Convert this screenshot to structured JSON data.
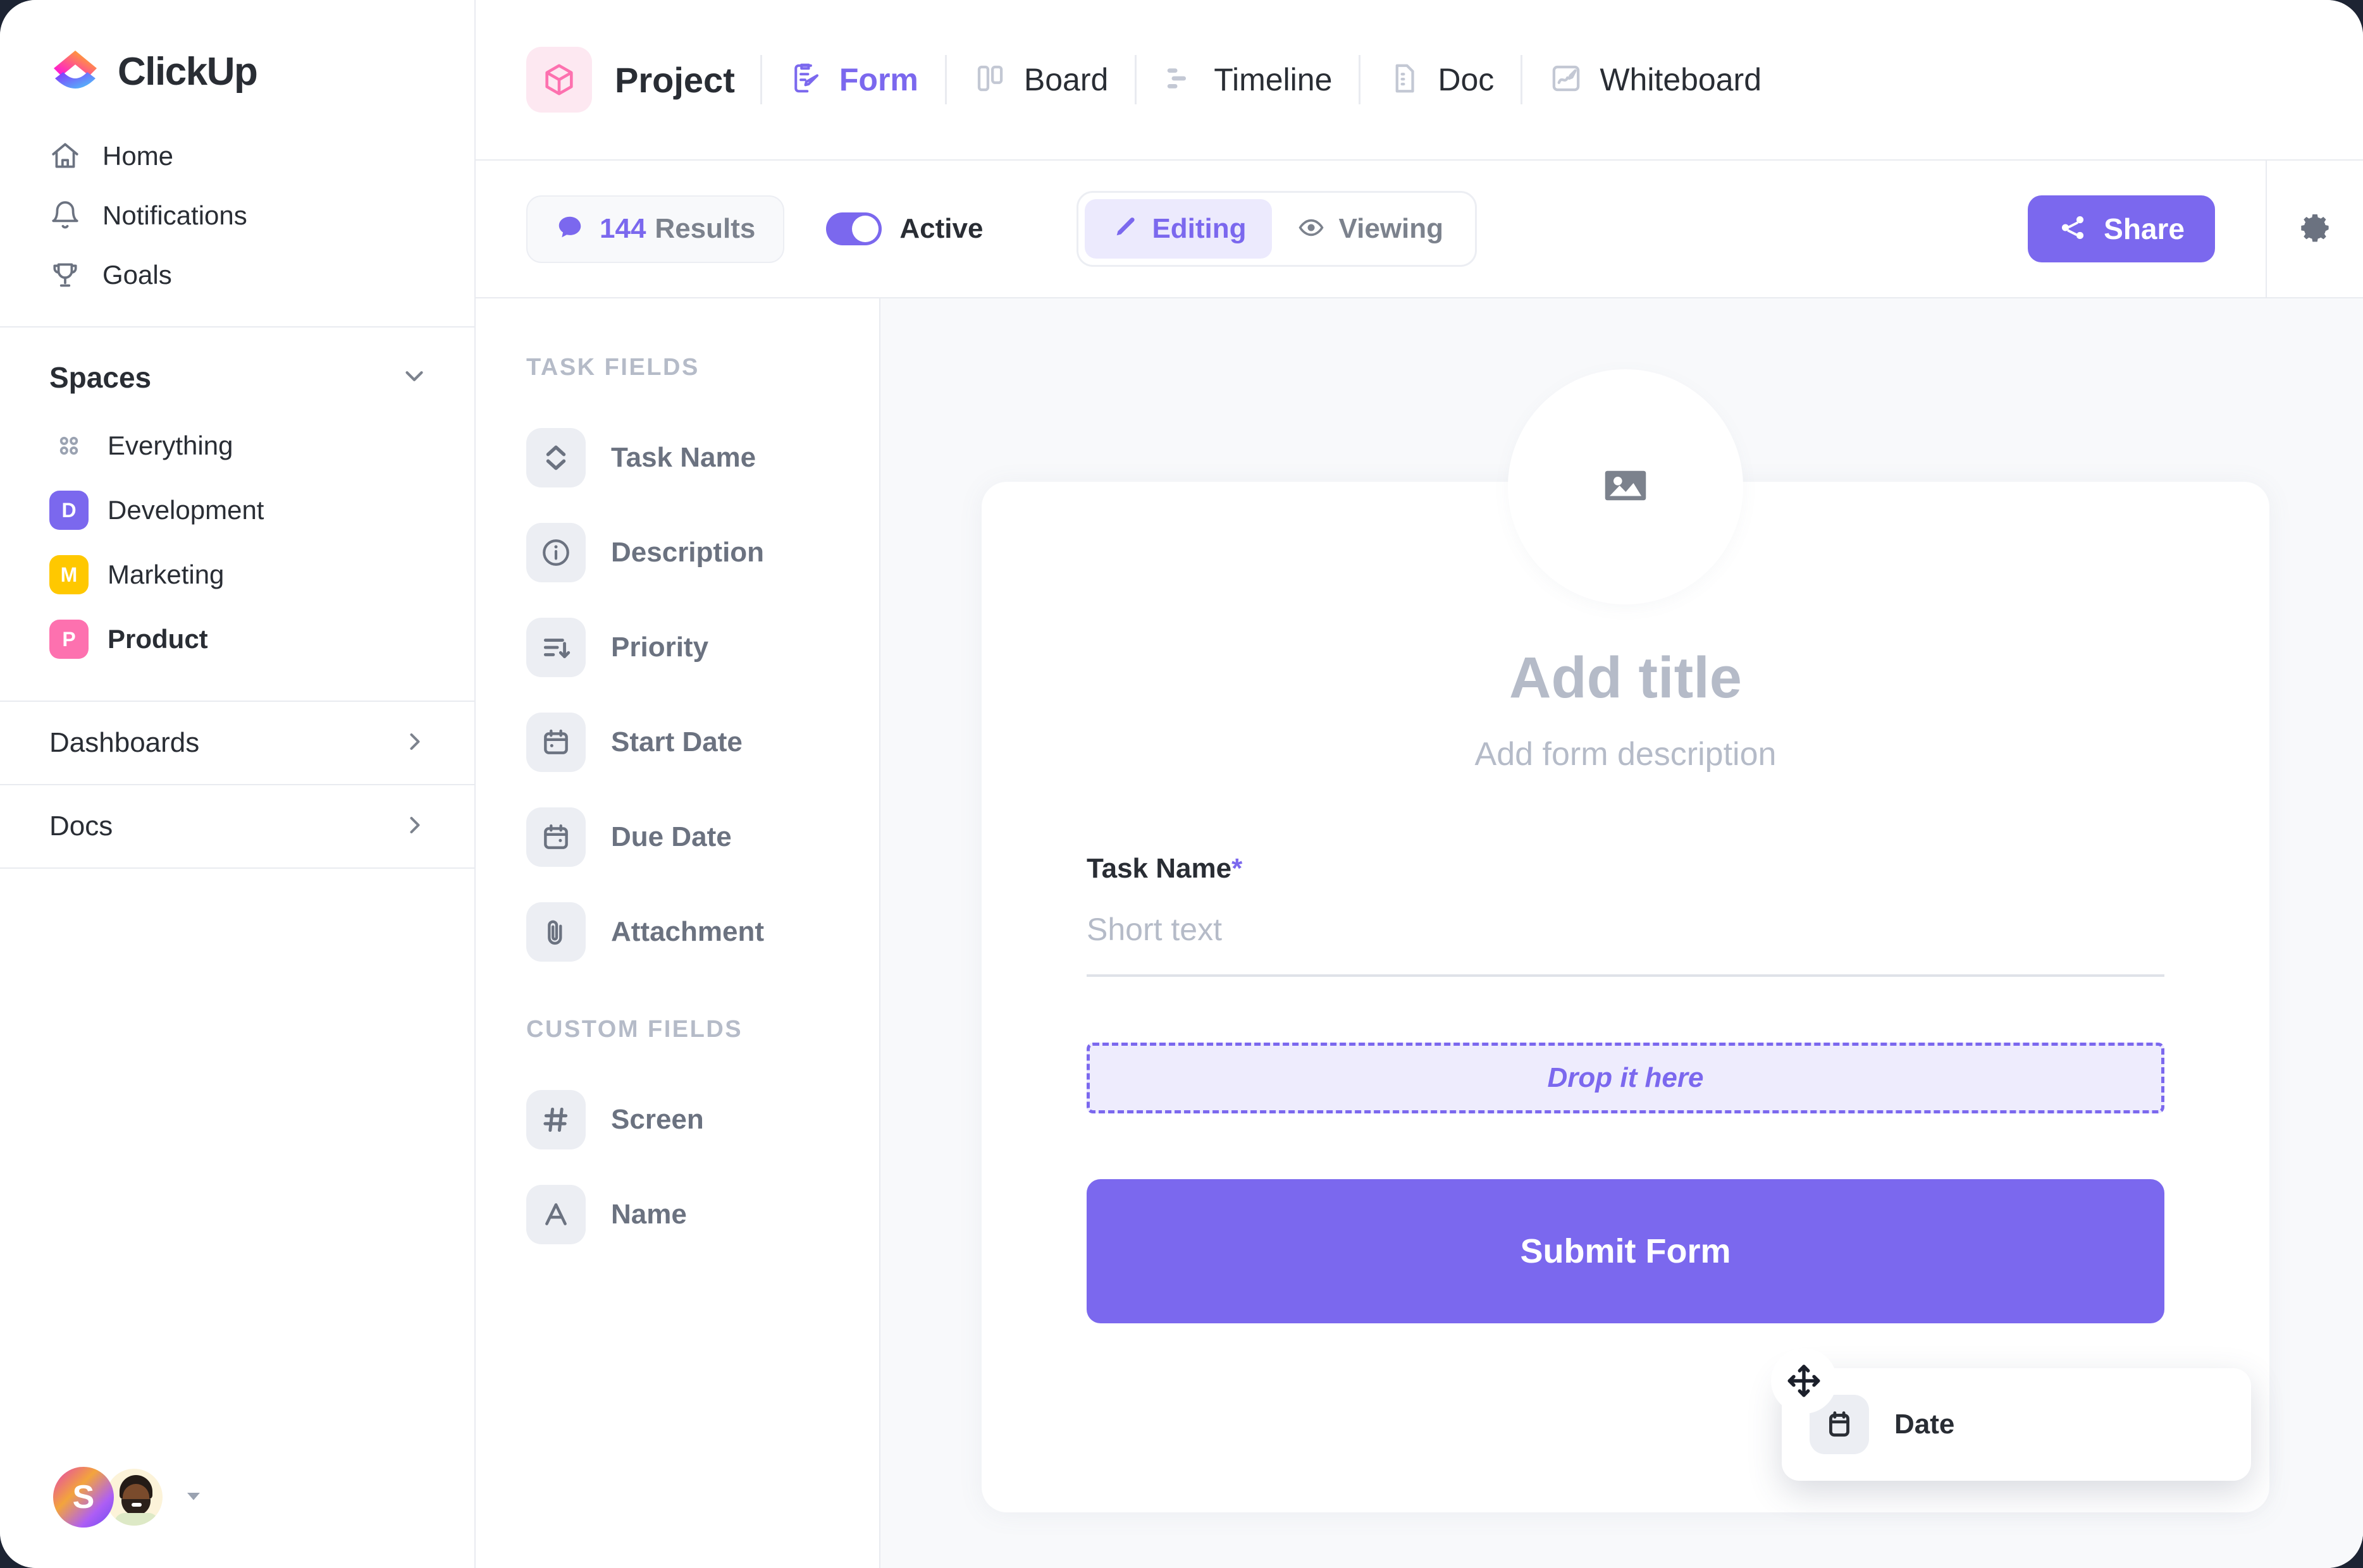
{
  "brand": {
    "name": "ClickUp",
    "accent": "#7b68ee",
    "pink": "#fd71af",
    "purple": "#7b68ee",
    "yellow": "#ffc800"
  },
  "sidebar": {
    "nav": [
      {
        "label": "Home",
        "icon": "home-icon"
      },
      {
        "label": "Notifications",
        "icon": "bell-icon"
      },
      {
        "label": "Goals",
        "icon": "trophy-icon"
      }
    ],
    "spaces_header": "Spaces",
    "spaces": [
      {
        "label": "Everything",
        "icon": "grid-dots-icon",
        "badge": "",
        "color": "",
        "active": false
      },
      {
        "label": "Development",
        "icon": "space-badge",
        "badge": "D",
        "color": "#7b68ee",
        "active": false
      },
      {
        "label": "Marketing",
        "icon": "space-badge",
        "badge": "M",
        "color": "#ffc800",
        "active": false
      },
      {
        "label": "Product",
        "icon": "space-badge",
        "badge": "P",
        "color": "#fd71af",
        "active": true
      }
    ],
    "collapsibles": [
      {
        "label": "Dashboards"
      },
      {
        "label": "Docs"
      }
    ],
    "footer": {
      "avatar_initial": "S"
    }
  },
  "topbar": {
    "project_name": "Project",
    "project_icon": "cube-icon",
    "views": [
      {
        "label": "Form",
        "icon": "form-icon",
        "active": true
      },
      {
        "label": "Board",
        "icon": "board-icon",
        "active": false
      },
      {
        "label": "Timeline",
        "icon": "timeline-icon",
        "active": false
      },
      {
        "label": "Doc",
        "icon": "doc-icon",
        "active": false
      },
      {
        "label": "Whiteboard",
        "icon": "whiteboard-icon",
        "active": false
      }
    ]
  },
  "toolbar": {
    "results_count": "144",
    "results_word": "Results",
    "results_icon": "comment-icon",
    "active_label": "Active",
    "active_on": true,
    "modes": [
      {
        "label": "Editing",
        "icon": "pencil-icon",
        "active": true
      },
      {
        "label": "Viewing",
        "icon": "eye-icon",
        "active": false
      }
    ],
    "share_label": "Share",
    "share_icon": "share-icon",
    "settings_icon": "gear-icon"
  },
  "fields_panel": {
    "task_fields_header": "TASK FIELDS",
    "task_fields": [
      {
        "label": "Task Name",
        "icon": "clickup-chevrons-icon"
      },
      {
        "label": "Description",
        "icon": "info-circle-icon"
      },
      {
        "label": "Priority",
        "icon": "priority-sort-icon"
      },
      {
        "label": "Start Date",
        "icon": "calendar-icon"
      },
      {
        "label": "Due Date",
        "icon": "calendar-icon"
      },
      {
        "label": "Attachment",
        "icon": "paperclip-icon"
      }
    ],
    "custom_fields_header": "CUSTOM FIELDS",
    "custom_fields": [
      {
        "label": "Screen",
        "icon": "hash-icon"
      },
      {
        "label": "Name",
        "icon": "letter-a-icon"
      }
    ]
  },
  "drag": {
    "card_label": "Date",
    "card_icon": "calendar-icon",
    "cursor_icon": "move-icon"
  },
  "form": {
    "cover_icon": "image-icon",
    "title_placeholder": "Add title",
    "description_placeholder": "Add form description",
    "fields": [
      {
        "label": "Task Name",
        "required_marker": "*",
        "input_placeholder": "Short text"
      }
    ],
    "dropzone_label": "Drop it here",
    "submit_label": "Submit Form"
  }
}
